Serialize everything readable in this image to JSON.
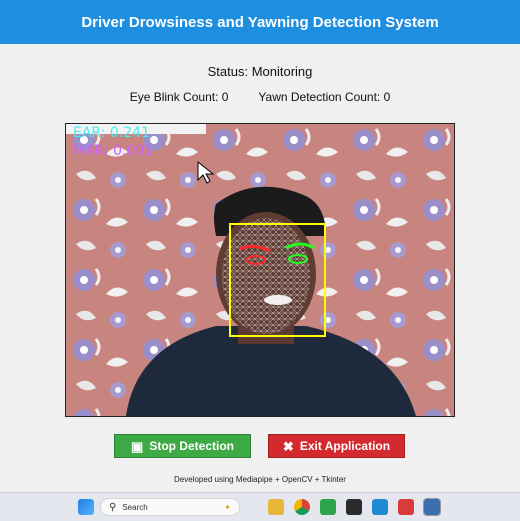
{
  "window": {
    "title": "Driver Drowsiness and Yawning Detection System"
  },
  "status": {
    "text": "Status: Monitoring"
  },
  "counts": {
    "blink_text": "Eye Blink Count: 0",
    "yawn_text": "Yawn Detection Count: 0"
  },
  "video": {
    "ear_text": "EAR: 0.241",
    "mar_text": "MAR: 0.001"
  },
  "buttons": {
    "stop_label": "Stop Detection",
    "exit_label": "Exit Application",
    "stop_icon": "stop-square-icon",
    "exit_icon": "close-x-icon",
    "stop_color": "#3daa46",
    "exit_color": "#d42a2f"
  },
  "footer": {
    "text": "Developed using Mediapipe + OpenCV + Tkinter"
  },
  "taskbar": {
    "search_placeholder": "Search",
    "icons": [
      "windows-start-icon",
      "search-icon",
      "widgets-icon",
      "file-explorer-icon",
      "chrome-icon",
      "app-icon",
      "terminal-icon",
      "vscode-icon",
      "app-red-icon",
      "python-tkinter-icon"
    ]
  },
  "colors": {
    "title_bar": "#1e8ee0",
    "ear_text": "#40f0f0",
    "mar_text": "#d060ff",
    "face_box": "#ffff00"
  }
}
